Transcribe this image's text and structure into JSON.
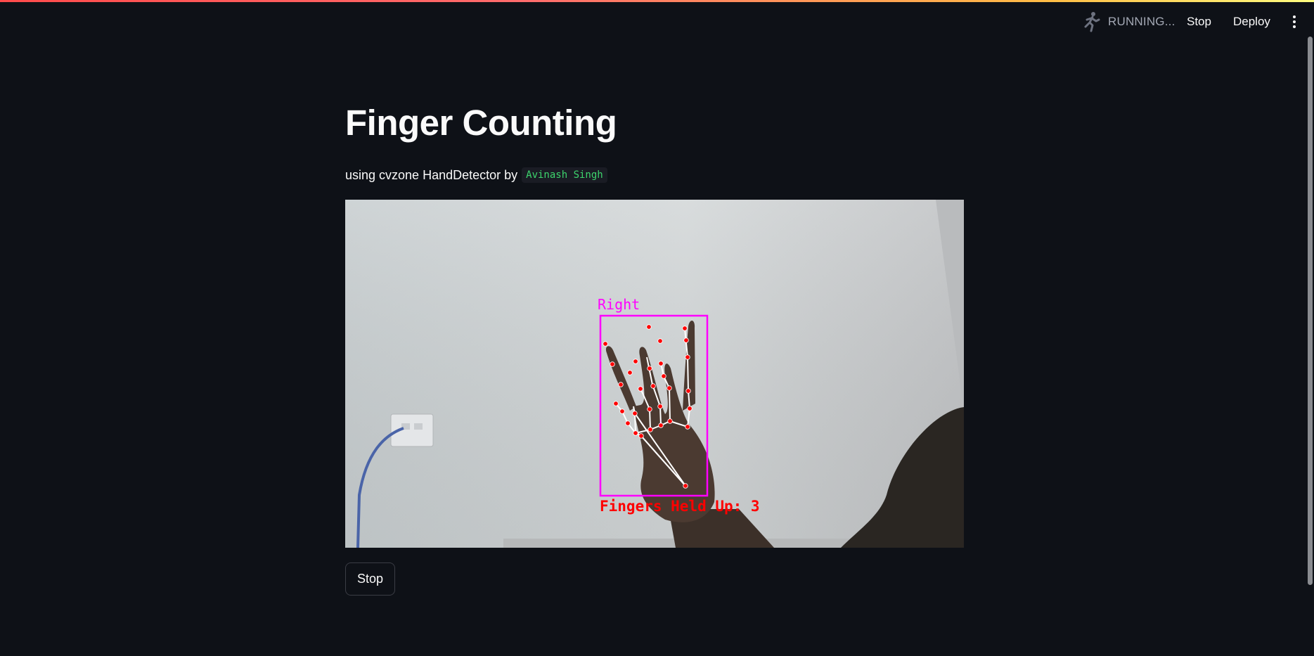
{
  "header": {
    "status_text": "RUNNING...",
    "stop_label": "Stop",
    "deploy_label": "Deploy",
    "status_icon": "running-man-icon",
    "menu_icon": "kebab-menu-icon"
  },
  "main": {
    "title": "Finger Counting",
    "subtitle_prefix": "using cvzone HandDetector by",
    "author": "Avinash Singh",
    "video": {
      "hand_label": "Right",
      "overlay_text": "Fingers Held Up: 3"
    },
    "stop_button_label": "Stop"
  },
  "colors": {
    "background": "#0e1117",
    "code_text": "#3dd56d",
    "overlay_magenta": "#ff00ff",
    "overlay_red": "#ff0000"
  }
}
